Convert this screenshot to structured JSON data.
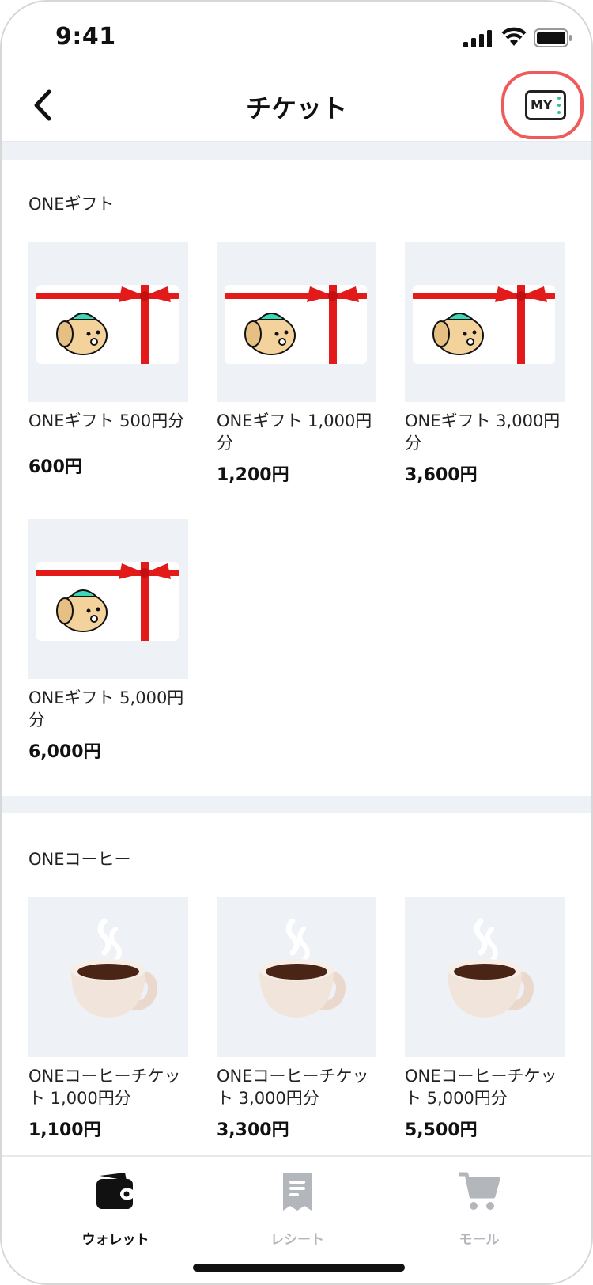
{
  "status_bar": {
    "time": "9:41"
  },
  "nav": {
    "title": "チケット",
    "my_button_label": "MY"
  },
  "sections": [
    {
      "title": "ONEギフト",
      "items": [
        {
          "name": "ONEギフト 500円分",
          "price": "600円"
        },
        {
          "name": "ONEギフト 1,000円分",
          "price": "1,200円"
        },
        {
          "name": "ONEギフト 3,000円分",
          "price": "3,600円"
        },
        {
          "name": "ONEギフト 5,000円分",
          "price": "6,000円"
        }
      ]
    },
    {
      "title": "ONEコーヒー",
      "items": [
        {
          "name": "ONEコーヒーチケット 1,000円分",
          "price": "1,100円"
        },
        {
          "name": "ONEコーヒーチケット 3,000円分",
          "price": "3,300円"
        },
        {
          "name": "ONEコーヒーチケット 5,000円分",
          "price": "5,500円"
        }
      ]
    }
  ],
  "tabbar": {
    "tabs": [
      {
        "label": "ウォレット",
        "icon": "wallet-icon",
        "active": true
      },
      {
        "label": "レシート",
        "icon": "receipt-icon",
        "active": false
      },
      {
        "label": "モール",
        "icon": "cart-icon",
        "active": false
      }
    ]
  },
  "colors": {
    "highlight": "#ef5a5a",
    "ribbon": "#e21a1a",
    "tab_active": "#111111",
    "tab_inactive": "#b3b7bc",
    "thumb_bg": "#eef1f5"
  }
}
